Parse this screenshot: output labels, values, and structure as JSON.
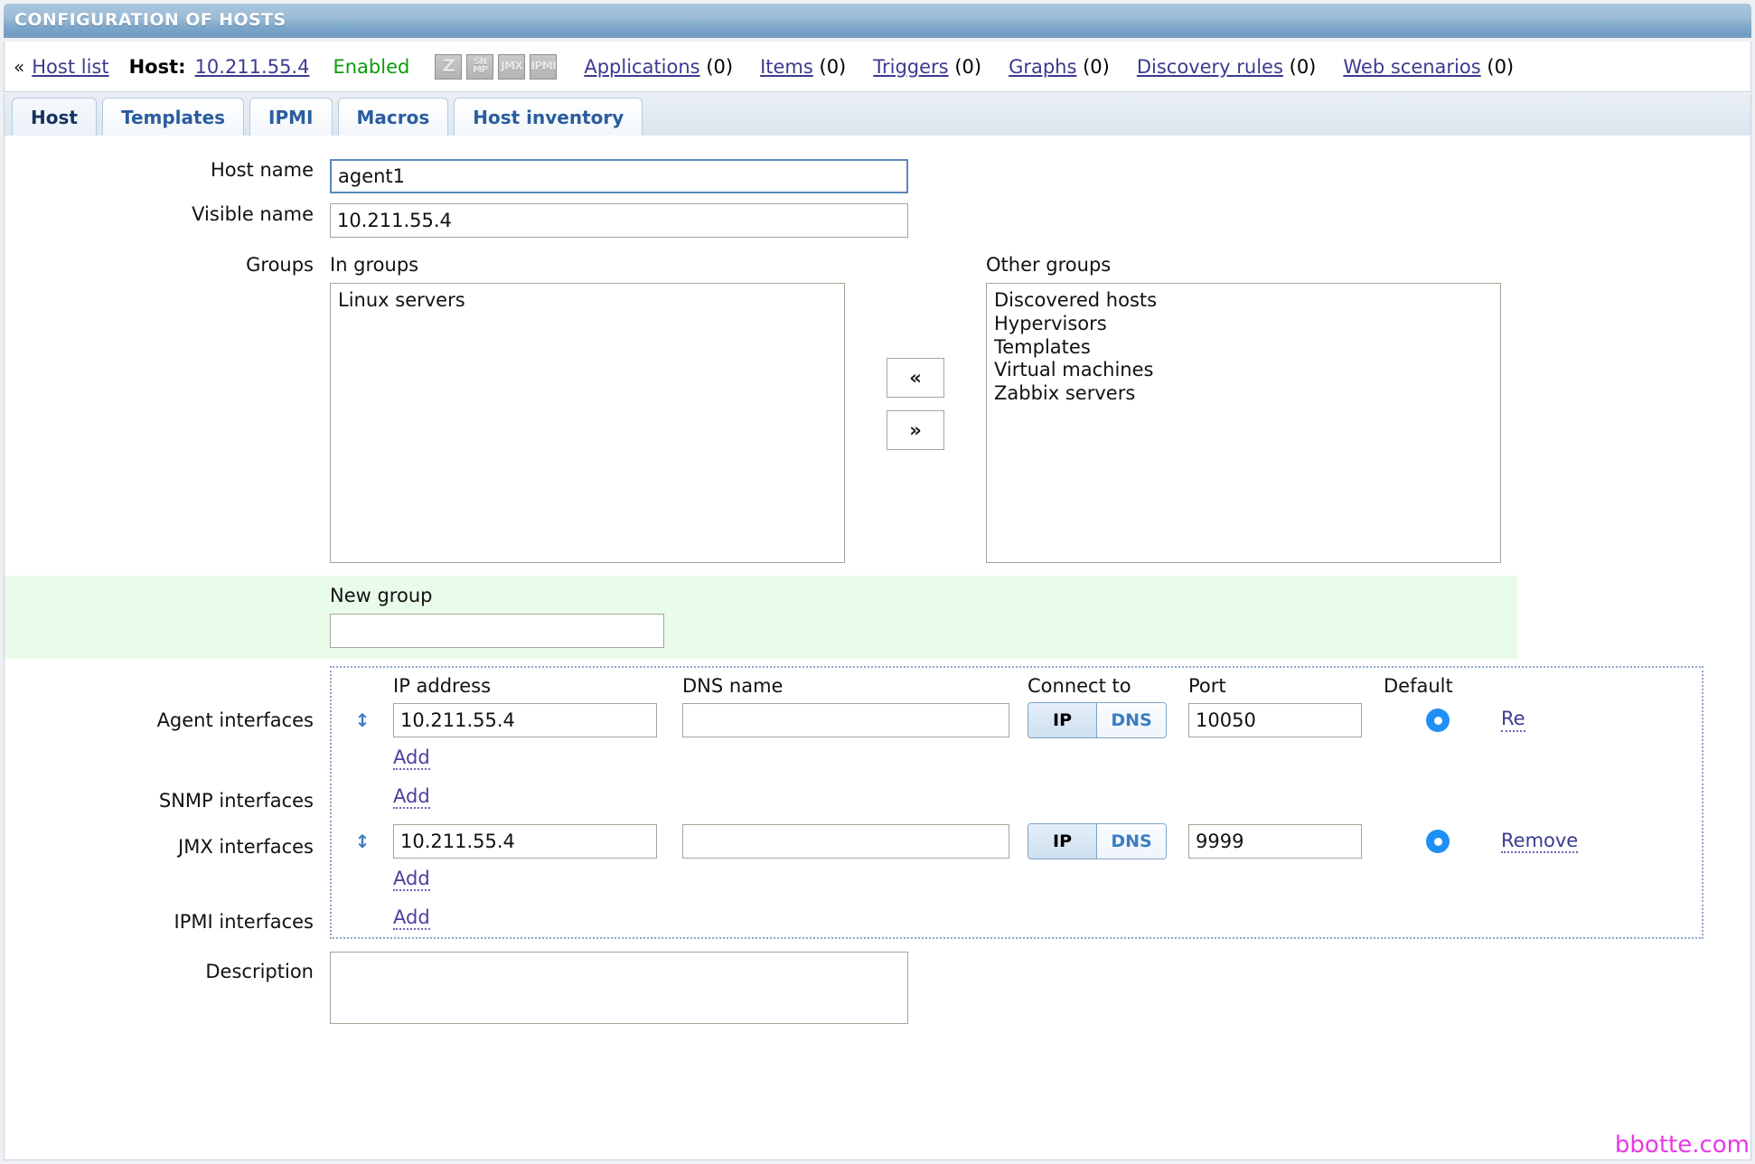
{
  "window": {
    "title": "CONFIGURATION OF HOSTS"
  },
  "nav": {
    "chevron": "«",
    "host_list": "Host list",
    "host_label": "Host:",
    "host_value": "10.211.55.4",
    "status": "Enabled",
    "badges": [
      {
        "name": "zabbix-agent-badge",
        "line1": "Z",
        "line2": ""
      },
      {
        "name": "snmp-badge",
        "line1": "SN",
        "line2": "MP"
      },
      {
        "name": "jmx-badge",
        "line1": "JMX",
        "line2": ""
      },
      {
        "name": "ipmi-badge",
        "line1": "IPMI",
        "line2": ""
      }
    ],
    "links": [
      {
        "label": "Applications",
        "count": "(0)"
      },
      {
        "label": "Items",
        "count": "(0)"
      },
      {
        "label": "Triggers",
        "count": "(0)"
      },
      {
        "label": "Graphs",
        "count": "(0)"
      },
      {
        "label": "Discovery rules",
        "count": "(0)"
      },
      {
        "label": "Web scenarios",
        "count": "(0)"
      }
    ]
  },
  "tabs": [
    {
      "label": "Host",
      "active": true
    },
    {
      "label": "Templates",
      "active": false
    },
    {
      "label": "IPMI",
      "active": false
    },
    {
      "label": "Macros",
      "active": false
    },
    {
      "label": "Host inventory",
      "active": false
    }
  ],
  "form": {
    "host_name": {
      "label": "Host name",
      "value": "agent1"
    },
    "visible_name": {
      "label": "Visible name",
      "value": "10.211.55.4"
    },
    "groups": {
      "label": "Groups",
      "in_groups_label": "In groups",
      "in_groups": [
        "Linux servers"
      ],
      "other_groups_label": "Other groups",
      "other_groups": [
        "Discovered hosts",
        "Hypervisors",
        "Templates",
        "Virtual machines",
        "Zabbix servers"
      ],
      "move_left": "«",
      "move_right": "»"
    },
    "new_group": {
      "label": "New group",
      "value": ""
    },
    "interface_columns": {
      "ip": "IP address",
      "dns": "DNS name",
      "connect_to": "Connect to",
      "port": "Port",
      "default": "Default"
    },
    "add_label": "Add",
    "remove_label": "Remove",
    "remove_label_clipped": "Re",
    "drag_handle": "↕",
    "connect_ip": "IP",
    "connect_dns": "DNS",
    "agent_interfaces": {
      "label": "Agent interfaces",
      "rows": [
        {
          "ip": "10.211.55.4",
          "dns": "",
          "connect": "IP",
          "port": "10050",
          "default": true
        }
      ]
    },
    "snmp_interfaces": {
      "label": "SNMP interfaces",
      "rows": []
    },
    "jmx_interfaces": {
      "label": "JMX interfaces",
      "rows": [
        {
          "ip": "10.211.55.4",
          "dns": "",
          "connect": "IP",
          "port": "9999",
          "default": true
        }
      ]
    },
    "ipmi_interfaces": {
      "label": "IPMI interfaces",
      "rows": []
    },
    "description": {
      "label": "Description",
      "value": ""
    }
  },
  "watermark": "bbotte.com",
  "colors": {
    "title_bar": "#7ba5c9",
    "link": "#3b3b8f",
    "enabled_green": "#0c9b0c",
    "new_group_bg": "#e9fbe9",
    "radio_blue": "#1e90f5",
    "watermark": "#e838e8"
  }
}
